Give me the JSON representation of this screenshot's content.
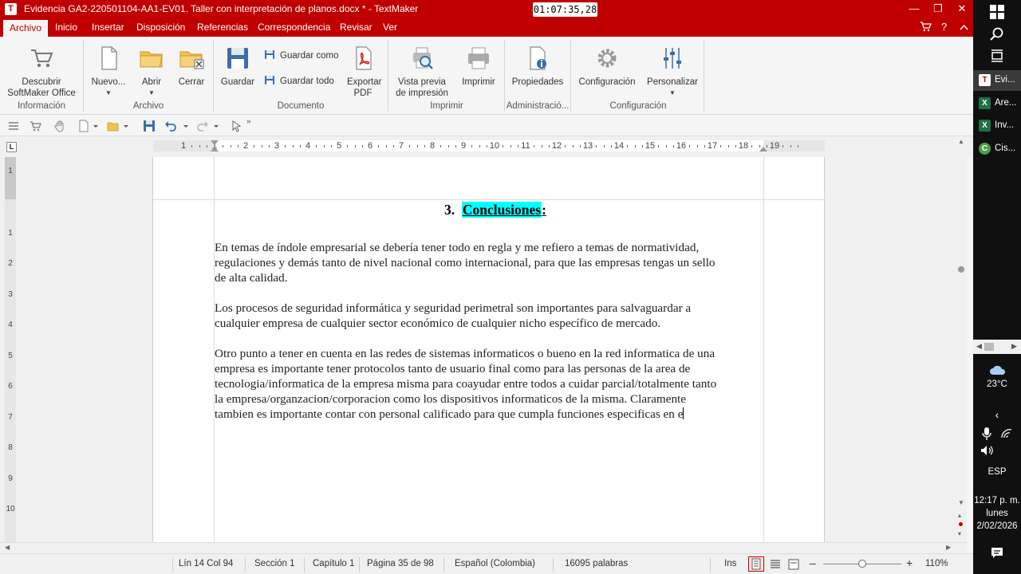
{
  "window": {
    "title": "Evidencia GA2-220501104-AA1-EV01. Taller con interpretación de planos.docx * - TextMaker",
    "timer": "01:07:35,28",
    "app_icon": "T"
  },
  "menu": {
    "items": [
      "Archivo",
      "Inicio",
      "Insertar",
      "Disposición",
      "Referencias",
      "Correspondencia",
      "Revisar",
      "Ver"
    ],
    "active": "Archivo"
  },
  "ribbon": {
    "buttons": {
      "descubrir": "Descubrir SoftMaker Office",
      "nuevo": "Nuevo...",
      "abrir": "Abrir",
      "cerrar": "Cerrar",
      "guardar": "Guardar",
      "guardar_como": "Guardar como",
      "guardar_todo": "Guardar todo",
      "exportar_pdf": "Exportar PDF",
      "vista_previa": "Vista previa de impresión",
      "imprimir": "Imprimir",
      "propiedades": "Propiedades",
      "configuracion": "Configuración",
      "personalizar": "Personalizar"
    },
    "groups": {
      "informacion": "Información",
      "archivo": "Archivo",
      "documento": "Documento",
      "imprimir": "Imprimir",
      "administracion": "Administració...",
      "configuracion": "Configuración"
    }
  },
  "ruler": {
    "numbers": [
      "1",
      "1",
      "2",
      "3",
      "4",
      "5",
      "6",
      "7",
      "8",
      "9",
      "10",
      "11",
      "12",
      "13",
      "14",
      "15",
      "16",
      "17",
      "18",
      "19"
    ],
    "corner": "L"
  },
  "vruler": {
    "numbers": [
      "1",
      "1",
      "2",
      "3",
      "4",
      "5",
      "6",
      "7",
      "8",
      "9",
      "10"
    ]
  },
  "document": {
    "heading_number": "3.",
    "heading_text": "Conclusiones",
    "heading_colon": ":",
    "paragraphs": [
      {
        "lines": [
          "En temas de índole empresarial se debería tener todo en regla y me refiero a temas de normatividad,",
          "regulaciones y demás tanto de nivel nacional como internacional, para que las empresas tengas un sello",
          "de alta calidad."
        ]
      },
      {
        "lines": [
          "Los procesos de seguridad informática y seguridad perimetral son importantes para salvaguardar a",
          "cualquier empresa de cualquier sector económico de cualquier nicho específico de mercado."
        ]
      },
      {
        "lines": [
          "Otro punto a tener en cuenta en las redes de sistemas informaticos o bueno en la red informatica de una",
          "empresa es importante tener protocolos tanto de usuario final como para las personas de la area de",
          "tecnologia/informatica de la empresa misma para coayudar entre todos a cuidar parcial/totalmente tanto",
          "la empresa/organzacion/corporacion como los dispositivos informaticos de la misma. Claramente",
          "tambien es importante contar con personal calificado para que cumpla funciones especificas en e"
        ]
      }
    ]
  },
  "status": {
    "position": "Lín 14 Col 94",
    "section": "Sección 1",
    "chapter": "Capítulo 1",
    "page": "Página 35 de 98",
    "language": "Español (Colombia)",
    "words": "16095 palabras",
    "mode": "Ins",
    "zoom": "110%",
    "zoom_slider_fraction": 0.5
  },
  "taskbar": {
    "apps": [
      {
        "badge": "T",
        "label": "Evi...",
        "color": "#c00000",
        "active": true
      },
      {
        "badge": "X",
        "label": "Are...",
        "color": "#1e7145",
        "active": false
      },
      {
        "badge": "X",
        "label": "Inv...",
        "color": "#1e7145",
        "active": false
      },
      {
        "badge": "C",
        "label": "Cis...",
        "color": "#4aa048",
        "active": false
      }
    ],
    "weather": "23°C",
    "language": "ESP",
    "time": "12:17 p. m.",
    "day": "lunes",
    "date": "2/02/2026"
  },
  "colors": {
    "accent": "#c00000",
    "highlight": "#00ffff"
  }
}
